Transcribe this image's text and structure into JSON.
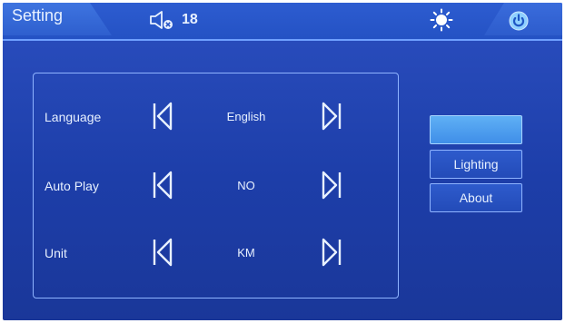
{
  "header": {
    "title": "Setting",
    "volume_icon": "speaker-muted-icon",
    "volume": "18",
    "brightness_icon": "sun-icon",
    "power_icon": "power-icon"
  },
  "settings": [
    {
      "label": "Language",
      "value": "English"
    },
    {
      "label": "Auto Play",
      "value": "NO"
    },
    {
      "label": "Unit",
      "value": "KM"
    }
  ],
  "side_menu": [
    {
      "label": "",
      "active": true
    },
    {
      "label": "Lighting",
      "active": false
    },
    {
      "label": "About",
      "active": false
    }
  ],
  "colors": {
    "background": "#1d3ea9",
    "accent": "#6fa0ff",
    "active_button": "#4f9ef0"
  }
}
